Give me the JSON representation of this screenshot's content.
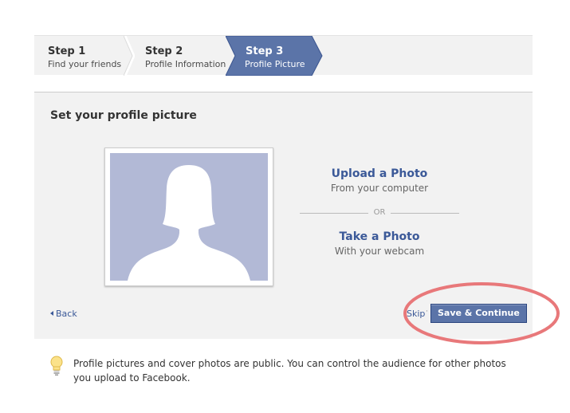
{
  "wizard": {
    "steps": [
      {
        "number": "Step 1",
        "label": "Find your friends",
        "state": "complete"
      },
      {
        "number": "Step 2",
        "label": "Profile Information",
        "state": "complete"
      },
      {
        "number": "Step 3",
        "label": "Profile Picture",
        "state": "active"
      }
    ],
    "active_color": "#5b74a8"
  },
  "main": {
    "title": "Set your profile picture",
    "placeholder_avatar_icon": "silhouette-avatar-icon",
    "upload": {
      "title": "Upload a Photo",
      "subtitle": "From your computer"
    },
    "divider_text": "OR",
    "webcam": {
      "title": "Take a Photo",
      "subtitle": "With your webcam"
    },
    "back_label": "Back",
    "skip_label": "Skip",
    "save_label": "Save & Continue"
  },
  "note": {
    "icon": "lightbulb-icon",
    "text": "Profile pictures and cover photos are public. You can control the audience for other photos you upload to Facebook."
  },
  "colors": {
    "link": "#3b5998",
    "button": "#5b74a8",
    "panel_bg": "#f2f2f2",
    "avatar_bg": "#b2b9d6",
    "annotation": "#e8787a"
  }
}
